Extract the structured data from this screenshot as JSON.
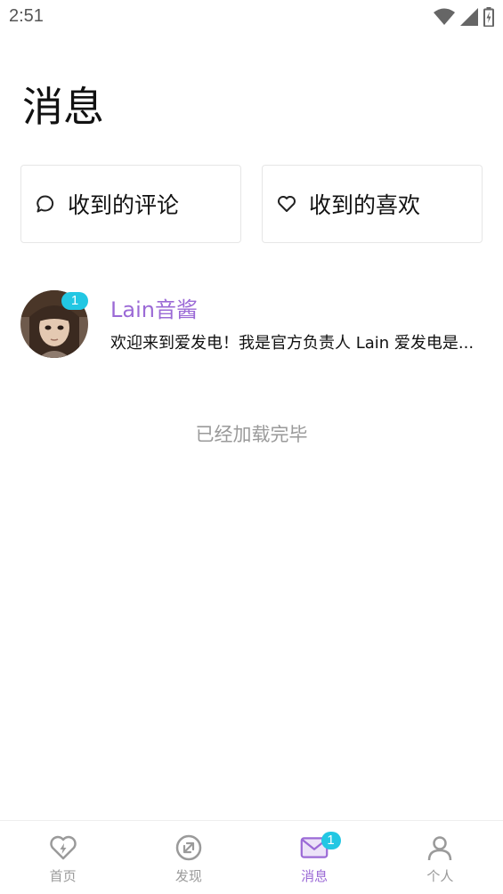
{
  "status_bar": {
    "time": "2:51",
    "icons": [
      "wifi-icon",
      "signal-icon",
      "battery-charging-icon"
    ]
  },
  "page": {
    "title": "消息"
  },
  "cards": [
    {
      "label": "收到的评论",
      "icon": "comment-icon"
    },
    {
      "label": "收到的喜欢",
      "icon": "heart-icon"
    }
  ],
  "messages": [
    {
      "name": "Lain音酱",
      "preview": "欢迎来到爱发电！我是官方负责人 Lain 爱发电是...",
      "unread": "1"
    }
  ],
  "end_note": "已经加载完毕",
  "tab_bar": {
    "tabs": [
      {
        "label": "首页",
        "icon": "home-heart-bolt-icon",
        "active": false
      },
      {
        "label": "发现",
        "icon": "discover-compass-icon",
        "active": false
      },
      {
        "label": "消息",
        "icon": "mail-icon",
        "active": true,
        "badge": "1"
      },
      {
        "label": "个人",
        "icon": "person-icon",
        "active": false
      }
    ]
  },
  "colors": {
    "accent": "#9b6ad6",
    "badge": "#22c7e3",
    "muted": "#9a9a9a",
    "border": "#e6e6e6"
  }
}
